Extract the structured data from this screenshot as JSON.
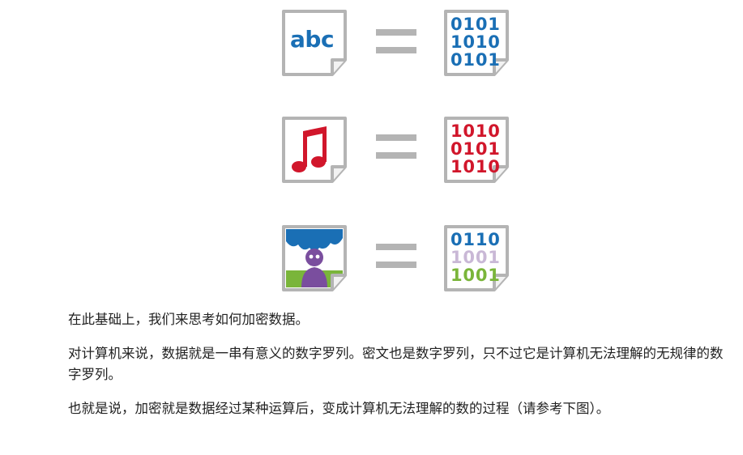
{
  "figure": {
    "rows": [
      {
        "icon": "text-document-icon",
        "icon_text": "abc",
        "bits": [
          "0101",
          "1010",
          "0101"
        ],
        "bit_colors": [
          "#1a6fb5",
          "#1a6fb5",
          "#1a6fb5"
        ]
      },
      {
        "icon": "music-note-icon",
        "icon_text": "♫",
        "bits": [
          "1010",
          "0101",
          "1010"
        ],
        "bit_colors": [
          "#d1162b",
          "#d1162b",
          "#d1162b"
        ]
      },
      {
        "icon": "image-file-icon",
        "icon_text": "",
        "bits": [
          "0110",
          "1001",
          "1001"
        ],
        "bit_colors": [
          "#1a6fb5",
          "#c9b8d6",
          "#7ab53a"
        ]
      }
    ],
    "colors": {
      "frame": "#b4b4b4",
      "equals": "#b4b4b4",
      "image_sky": "#1a6fb5",
      "image_figure": "#7a4e9e",
      "image_grass": "#7ab53a"
    }
  },
  "text": {
    "p1": "在此基础上，我们来思考如何加密数据。",
    "p2": "对计算机来说，数据就是一串有意义的数字罗列。密文也是数字罗列，只不过它是计算机无法理解的无规律的数字罗列。",
    "p3": "也就是说，加密就是数据经过某种运算后，变成计算机无法理解的数的过程（请参考下图）。"
  }
}
